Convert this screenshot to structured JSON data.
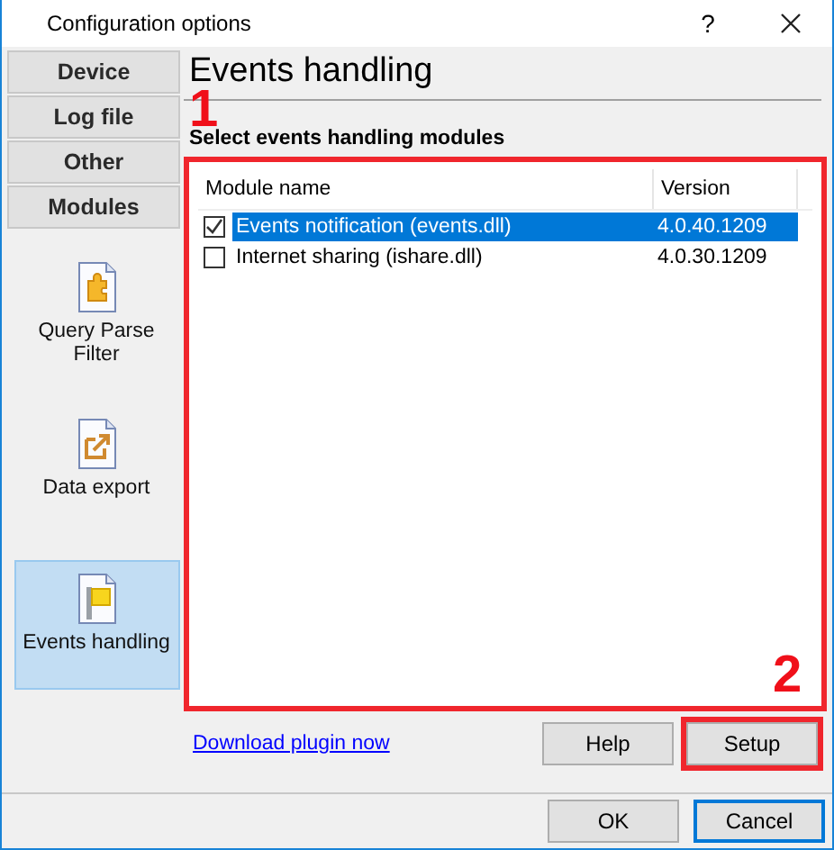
{
  "window": {
    "title": "Configuration options",
    "help": "?"
  },
  "nav_tabs": [
    {
      "label": "Device",
      "selected": false
    },
    {
      "label": "Log file",
      "selected": false
    },
    {
      "label": "Other",
      "selected": false
    },
    {
      "label": "Modules",
      "selected": false
    }
  ],
  "modules": [
    {
      "label": "Query Parse Filter",
      "selected": false
    },
    {
      "label": "Data export",
      "selected": false
    },
    {
      "label": "Events handling",
      "selected": true
    }
  ],
  "page": {
    "title": "Events handling",
    "section_label": "Select events handling modules",
    "table": {
      "columns": [
        "Module name",
        "Version"
      ],
      "rows": [
        {
          "name": "Events notification (events.dll)",
          "version": "4.0.40.1209",
          "checked": true,
          "selected": true
        },
        {
          "name": "Internet sharing (ishare.dll)",
          "version": "4.0.30.1209",
          "checked": false,
          "selected": false
        }
      ]
    },
    "link": "Download plugin now",
    "buttons": [
      "Help",
      "Setup"
    ]
  },
  "annotations": [
    "1",
    "2"
  ],
  "footer_buttons": [
    {
      "label": "OK",
      "default": false
    },
    {
      "label": "Cancel",
      "default": true
    }
  ]
}
